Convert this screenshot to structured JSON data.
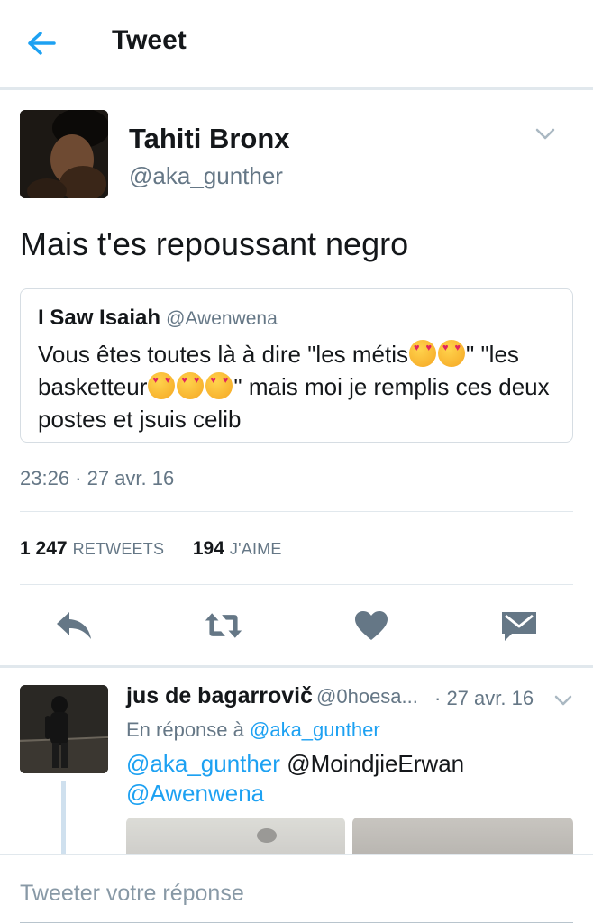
{
  "header": {
    "title": "Tweet",
    "back_icon": "back-arrow-icon"
  },
  "tweet": {
    "author_name": "Tahiti Bronx",
    "author_handle": "@aka_gunther",
    "text": "Mais t'es repoussant negro",
    "quote": {
      "name": "I Saw Isaiah",
      "handle": "@Awenwena",
      "text_1": "Vous êtes toutes là à dire \"les métis",
      "text_2": "\" \"les basketteur",
      "text_3": "\" mais moi je remplis ces deux postes et jsuis celib",
      "emoji_icon": "heart-eyes-emoji"
    },
    "timestamp": "23:26 · 27 avr. 16",
    "retweets_count": "1 247",
    "retweets_label": "RETWEETS",
    "likes_count": "194",
    "likes_label": "J'AIME"
  },
  "actions": [
    "reply-icon",
    "retweet-icon",
    "heart-icon",
    "direct-message-icon"
  ],
  "reply": {
    "name": "jus de bagarrovič",
    "handle": "@0hoesa...",
    "time": "· 27 avr. 16",
    "in_reply_prefix": "En réponse à",
    "in_reply_handle": "@aka_gunther",
    "mention_1": "@aka_gunther",
    "mention_2": "@MoindjieErwan",
    "mention_3": "@Awenwena"
  },
  "compose": {
    "placeholder": "Tweeter votre réponse"
  },
  "colors": {
    "accent": "#1da1f2",
    "icon_gray": "#657786",
    "border": "#e1e8ed"
  }
}
